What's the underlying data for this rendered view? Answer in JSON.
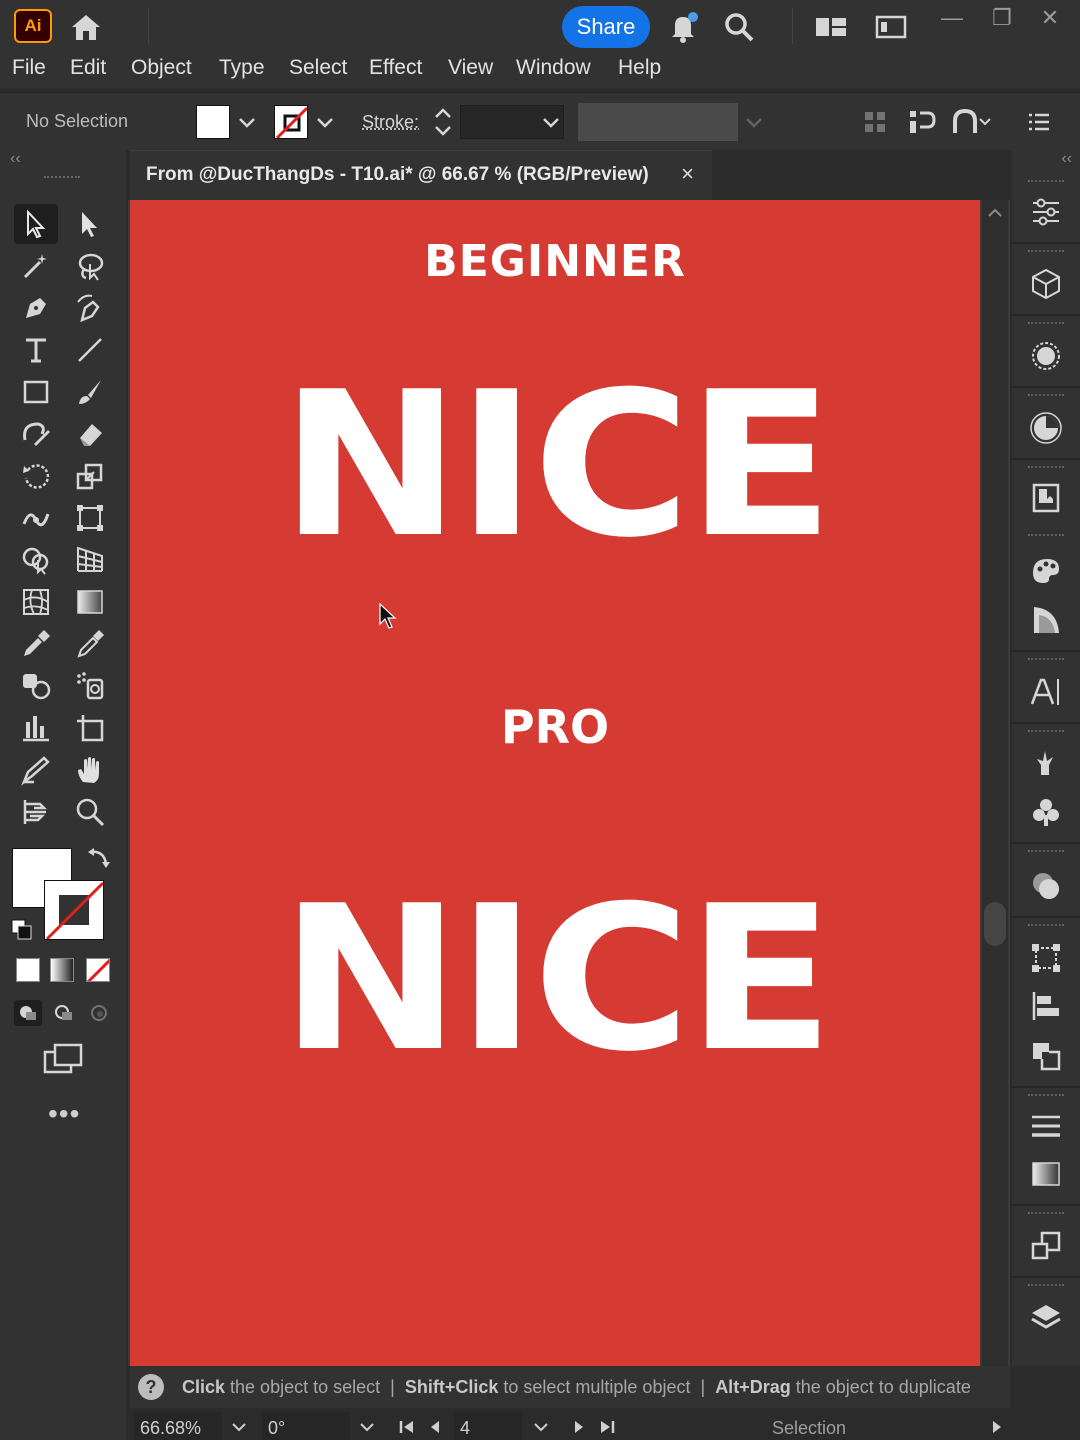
{
  "app": {
    "logo_text": "Ai",
    "share_label": "Share",
    "accent": "#1473e6",
    "brand": "#ff9a00"
  },
  "menu": [
    "File",
    "Edit",
    "Object",
    "Type",
    "Select",
    "Effect",
    "View",
    "Window",
    "Help"
  ],
  "control_bar": {
    "selection_status": "No Selection",
    "stroke_label": "Stroke:"
  },
  "document": {
    "tab_title": "From @DucThangDs - T10.ai* @ 66.67 % (RGB/Preview)",
    "close_glyph": "×"
  },
  "artboard": {
    "background": "#d63b33",
    "texts": {
      "beginner": "BEGINNER",
      "nice_top": "NICE",
      "pro": "PRO",
      "nice_bottom": "NICE"
    }
  },
  "hint_bar": {
    "question": "?",
    "part1_bold": "Click",
    "part1_rest": " the object to select",
    "part2_bold": "Shift+Click",
    "part2_rest": " to select multiple object",
    "part3_bold": "Alt+Drag",
    "part3_rest": " the object to duplicate",
    "separator": "|"
  },
  "status_bar": {
    "zoom": "66.68%",
    "rotation": "0°",
    "artboard_number": "4",
    "current_tool": "Selection"
  },
  "panels": {
    "collapse_glyph": "‹‹",
    "more_tools": "•••"
  }
}
